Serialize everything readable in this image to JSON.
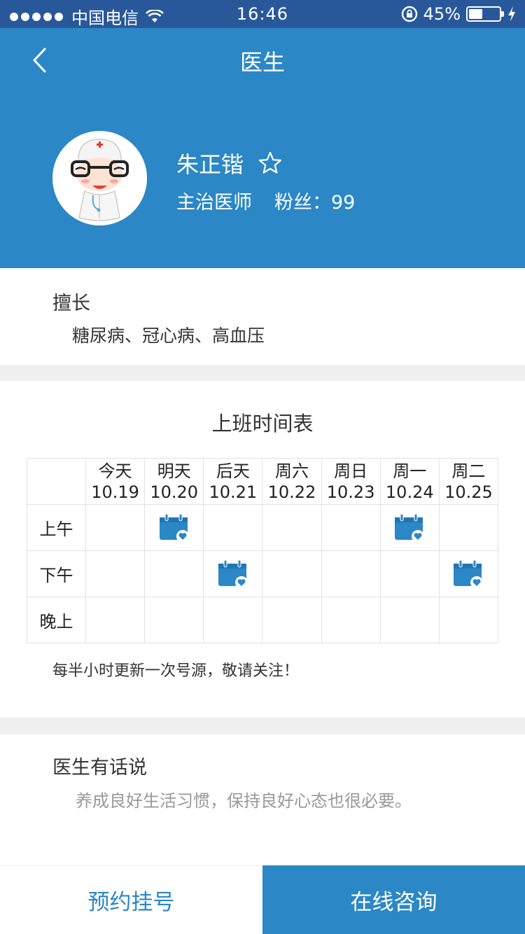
{
  "status_bar": {
    "carrier": "中国电信",
    "time": "16:46",
    "battery": "45%",
    "battery_level": 0.45
  },
  "nav": {
    "title": "医生",
    "back_icon": "chevron-left-icon"
  },
  "doctor": {
    "name": "朱正锴",
    "title": "主治医师",
    "fans": "粉丝：99",
    "favorite_icon": "star-outline-icon"
  },
  "specialty": {
    "label": "擅长",
    "text": "糖尿病、冠心病、高血压"
  },
  "schedule": {
    "title": "上班时间表",
    "days": [
      {
        "name": "今天",
        "date": "10.19"
      },
      {
        "name": "明天",
        "date": "10.20"
      },
      {
        "name": "后天",
        "date": "10.21"
      },
      {
        "name": "周六",
        "date": "10.22"
      },
      {
        "name": "周日",
        "date": "10.23"
      },
      {
        "name": "周一",
        "date": "10.24"
      },
      {
        "name": "周二",
        "date": "10.25"
      }
    ],
    "periods": [
      "上午",
      "下午",
      "晚上"
    ],
    "available": [
      [
        false,
        true,
        false,
        false,
        false,
        true,
        false
      ],
      [
        false,
        false,
        true,
        false,
        false,
        false,
        true
      ],
      [
        false,
        false,
        false,
        false,
        false,
        false,
        false
      ]
    ],
    "notice": "每半小时更新一次号源，敬请关注！"
  },
  "doctor_words": {
    "label": "医生有话说",
    "text": "养成良好生活习惯，保持良好心态也很必要。"
  },
  "actions": {
    "appoint": "预约挂号",
    "consult": "在线咨询"
  },
  "colors": {
    "primary": "#2b87c6",
    "status_bar": "#29589a",
    "divider": "#f0f0f0"
  }
}
